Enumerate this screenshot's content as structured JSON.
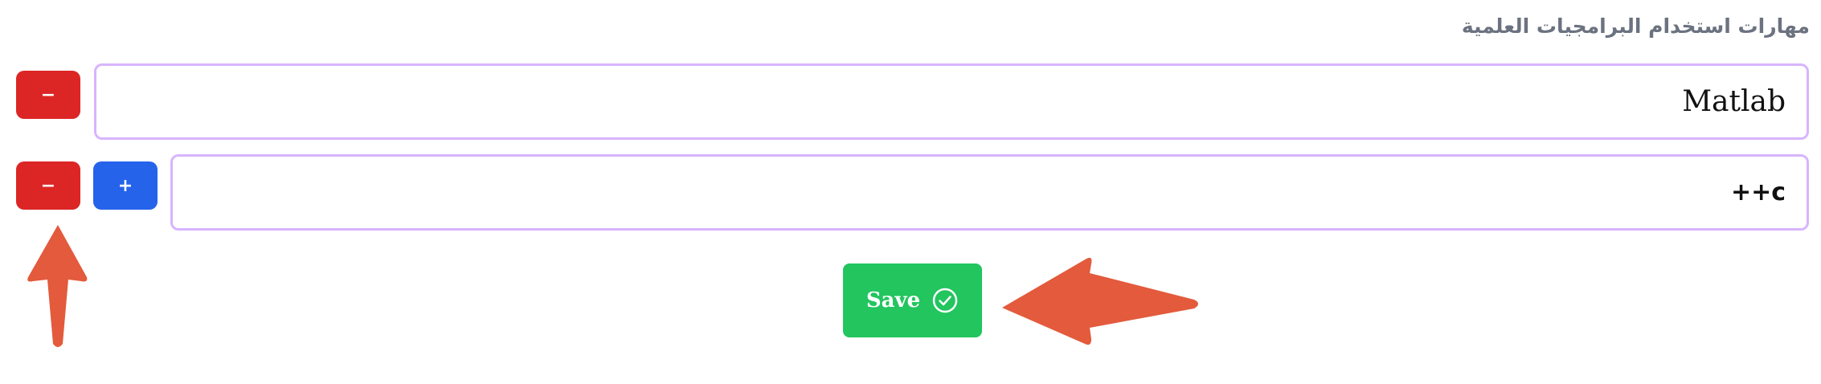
{
  "section": {
    "label": "مهارات استخدام البرامجيات العلمية"
  },
  "skills": [
    {
      "value": "Matlab",
      "remove_label": "−"
    },
    {
      "value": "++c",
      "remove_label": "−",
      "add_label": "+"
    }
  ],
  "save": {
    "label": "Save",
    "icon": "check-circle-icon"
  },
  "colors": {
    "remove": "#dc2626",
    "add": "#2563eb",
    "save": "#22c55e",
    "field_border": "#d8b4fe",
    "annotation_arrow": "#e35a3c"
  }
}
